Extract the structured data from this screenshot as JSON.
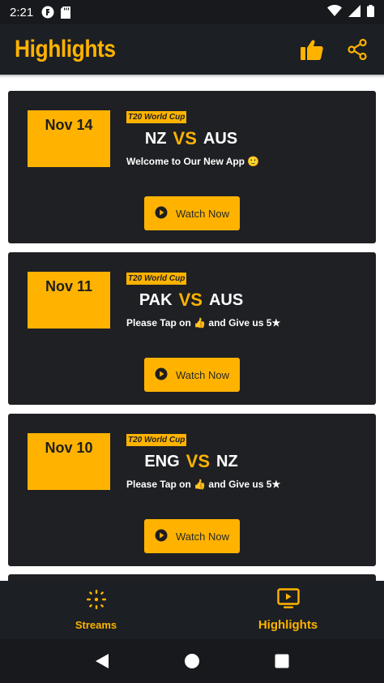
{
  "status_bar": {
    "time": "2:21"
  },
  "app_bar": {
    "title": "Highlights",
    "icons": [
      "thumbs-up-icon",
      "share-icon"
    ]
  },
  "colors": {
    "accent": "#ffb300",
    "card_bg": "#1e2023",
    "bar_bg": "#1c1f23"
  },
  "matches": [
    {
      "date": "Nov 14",
      "tournament": "T20 World Cup",
      "team1": "NZ",
      "vs": "VS",
      "team2": "AUS",
      "message": "Welcome to Our New App 🙂",
      "button": "Watch Now"
    },
    {
      "date": "Nov 11",
      "tournament": "T20 World Cup",
      "team1": "PAK",
      "vs": "VS",
      "team2": "AUS",
      "message": "Please Tap on 👍 and Give us 5★",
      "button": "Watch Now"
    },
    {
      "date": "Nov 10",
      "tournament": "T20 World Cup",
      "team1": "ENG",
      "vs": "VS",
      "team2": "NZ",
      "message": "Please Tap on 👍 and Give us 5★",
      "button": "Watch Now"
    }
  ],
  "bottom_nav": [
    {
      "label": "Streams",
      "icon": "streams-icon"
    },
    {
      "label": "Highlights",
      "icon": "tv-play-icon",
      "selected": true
    }
  ],
  "system_nav": [
    "back-icon",
    "home-icon",
    "recents-icon"
  ]
}
